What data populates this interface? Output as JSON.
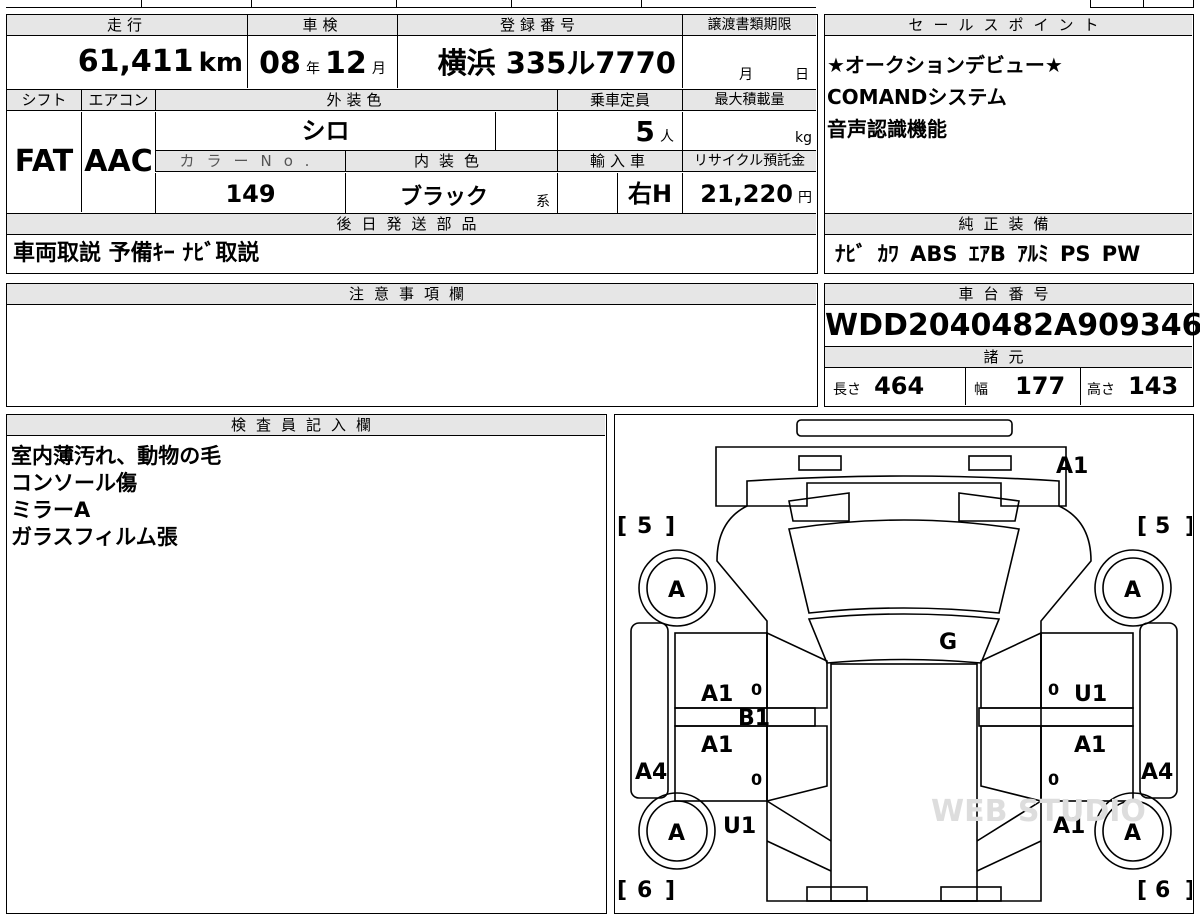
{
  "header": {
    "mileage_label": "走行",
    "mileage_value": "61,411",
    "mileage_unit": "km",
    "inspection_label": "車検",
    "inspection_year": "08",
    "inspection_year_unit": "年",
    "inspection_month": "12",
    "inspection_month_unit": "月",
    "registration_label": "登録番号",
    "registration_value": "横浜 335ル7770",
    "transfer_label": "譲渡書類期限",
    "transfer_month": "月",
    "transfer_day": "日"
  },
  "row2": {
    "shift_label": "シフト",
    "shift_value": "FAT",
    "aircon_label": "エアコン",
    "aircon_value": "AAC",
    "exterior_label": "外装色",
    "exterior_value": "シロ",
    "capacity_label": "乗車定員",
    "capacity_value": "5",
    "capacity_unit": "人",
    "maxload_label": "最大積載量",
    "maxload_unit": "kg",
    "color_no_label": "カラーNo.",
    "color_no_value": "149",
    "interior_label": "内装色",
    "interior_value": "ブラック",
    "interior_suffix": "系",
    "import_label": "輸入車",
    "import_value": "右H",
    "recycle_label": "リサイクル預託金",
    "recycle_value": "21,220",
    "recycle_unit": "円"
  },
  "later_parts": {
    "label": "後日発送部品",
    "value": "車両取説 予備ｷｰ ﾅﾋﾞ取説"
  },
  "notes": {
    "label": "注意事項欄"
  },
  "sales_points": {
    "label": "セールスポイント",
    "lines": [
      "★オークションデビュー★",
      "COMANDシステム",
      "音声認識機能"
    ]
  },
  "equipment": {
    "label": "純正装備",
    "value": "ﾅﾋﾞ ｶﾜ ABS ｴｱB ｱﾙﾐ PS PW"
  },
  "chassis": {
    "label": "車台番号",
    "value": "WDD2040482A909346",
    "spec_label": "諸元",
    "length_label": "長さ",
    "length_value": "464",
    "width_label": "幅",
    "width_value": "177",
    "height_label": "高さ",
    "height_value": "143"
  },
  "inspector": {
    "label": "検査員記入欄",
    "lines": [
      "室内薄汚れ、動物の毛",
      "コンソール傷",
      "ミラーA",
      "ガラスフィルム張"
    ]
  },
  "diagram": {
    "rear_left_tire": "5",
    "rear_right_tire": "5",
    "front_left_tire": "6",
    "front_right_tire": "6",
    "wheel_ul": "A",
    "wheel_ur": "A",
    "wheel_ll": "A",
    "wheel_lr": "A",
    "trunk": "A1",
    "glass": "G",
    "left_rear_door": "A1",
    "left_mid": "B1",
    "left_front_door": "A1",
    "left_quarter": "A4",
    "left_fender": "U1",
    "right_rear_door": "U1",
    "right_front_door": "A1",
    "right_quarter": "A4",
    "right_fender": "A1",
    "zero_marker": "0",
    "watermark": "WEB STUDIO"
  }
}
